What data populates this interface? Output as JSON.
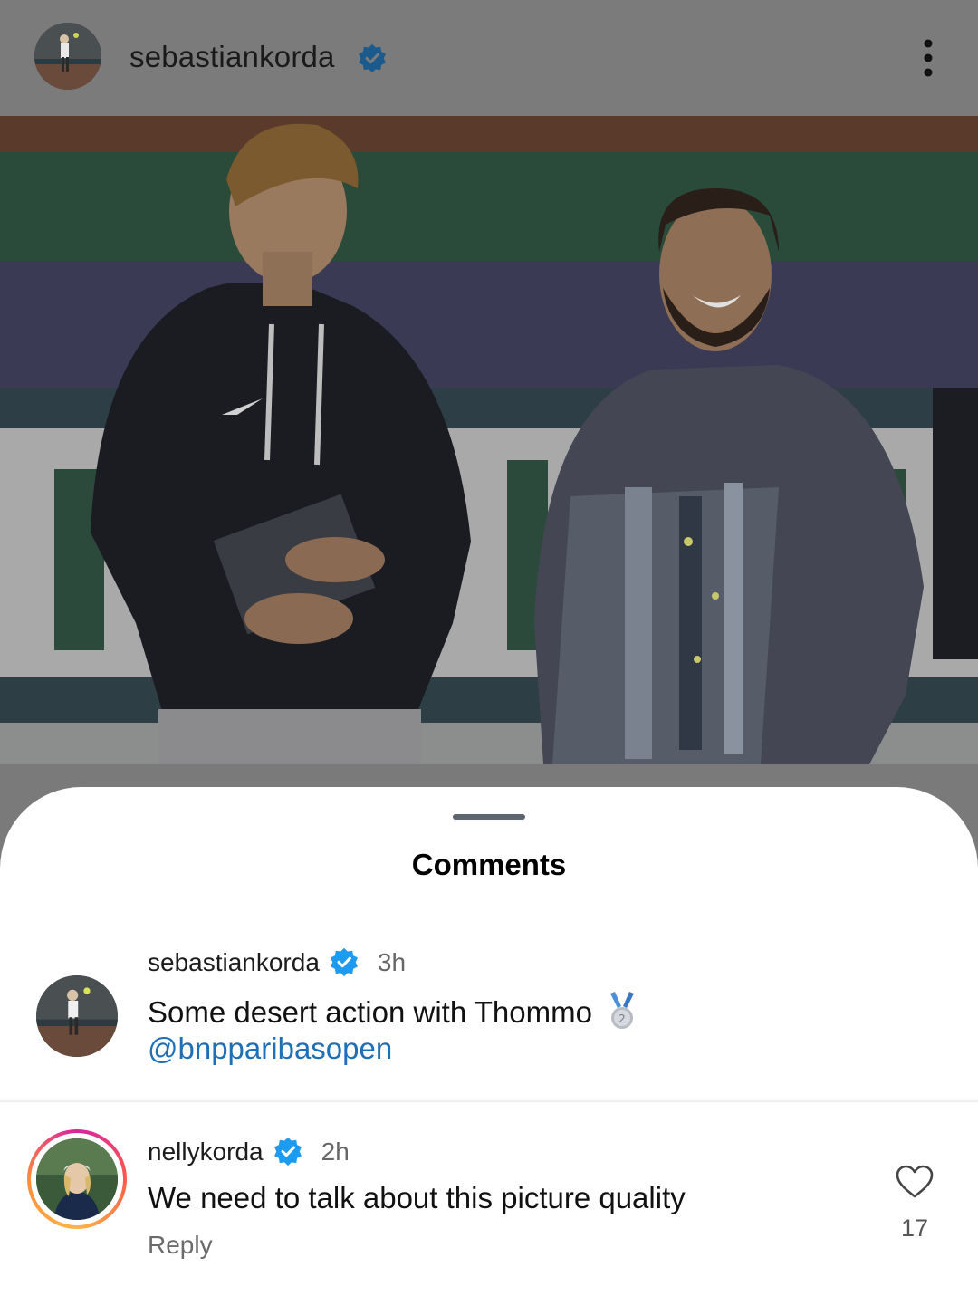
{
  "post": {
    "username": "sebastiankorda"
  },
  "sheet": {
    "title": "Comments"
  },
  "comments": [
    {
      "username": "sebastiankorda",
      "time": "3h",
      "text": "Some desert action with Thommo",
      "mention": "@bnpparibasopen"
    },
    {
      "username": "nellykorda",
      "time": "2h",
      "text": "We need to talk about this picture quality",
      "reply_label": "Reply",
      "like_count": "17"
    }
  ],
  "colors": {
    "verified": "#1d9bf0",
    "mention": "#1d6fb8",
    "overlay": "#7a7a7a"
  },
  "icons": [
    "verified-badge-icon",
    "more-options-icon",
    "silver-medal-icon",
    "heart-icon"
  ]
}
